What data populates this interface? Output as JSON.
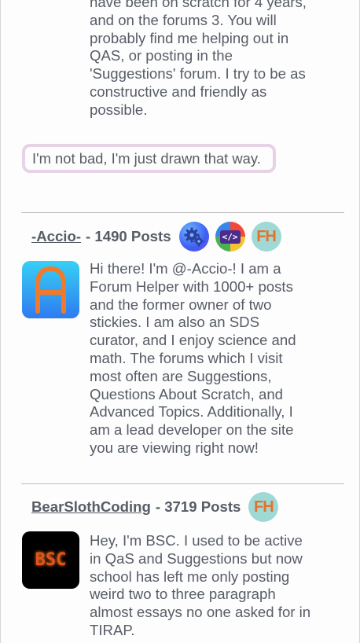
{
  "top_bio": {
    "lines": [
      "have been on scratch for 4 years,",
      "and on the forums 3. You will",
      "probably find me helping out in",
      "QAS, or posting in the",
      "'Suggestions' forum. I try to be as",
      "constructive and friendly as",
      "possible."
    ]
  },
  "quote": "I'm not bad, I'm just drawn that way.",
  "posters": [
    {
      "username": "-Accio-",
      "posts": "- 1490 Posts",
      "badges": [
        "gears-badge-icon",
        "code-badge-icon",
        "forum-helper-badge-icon"
      ],
      "avatar": "letter-a-avatar",
      "bio_lines": [
        "Hi there! I'm @-Accio-! I am a",
        "Forum Helper with 1000+ posts",
        "and the former owner of two",
        "stickies. I am also an SDS",
        "curator, and I enjoy science and",
        "math. The forums which I visit",
        "most often are Suggestions,",
        "Questions About Scratch, and",
        "Advanced Topics. Additionally, I",
        "am a lead developer on the site",
        "you are viewing right now!"
      ]
    },
    {
      "username": "BearSlothCoding",
      "posts": "- 3719 Posts",
      "badges": [
        "forum-helper-badge-icon"
      ],
      "avatar": "bsc-avatar",
      "avatar_text": "BSC",
      "bio_lines": [
        "Hey, I'm BSC. I used to be active",
        "in QaS and Suggestions but now",
        "school has left me only posting",
        "weird two to three paragraph",
        "almost essays no one asked for in",
        "TIRAP."
      ]
    }
  ],
  "badge_text": {
    "code": "</>",
    "forum_helper": "FH"
  },
  "colors": {
    "text": "#575c66",
    "quote_border": "#e8d3e6",
    "divider": "#bdbdbd",
    "accio_avatar_bg": "#2f8df0",
    "accio_letter": "#f07a2c",
    "bsc_avatar_bg": "#000000",
    "bsc_text": "#e2541b"
  }
}
